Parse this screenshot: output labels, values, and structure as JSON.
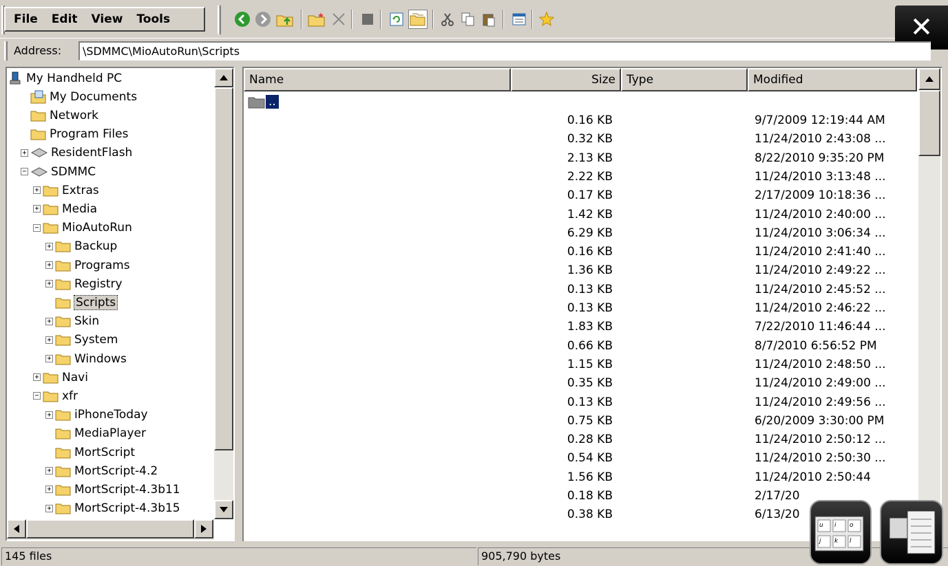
{
  "menu": {
    "file": "File",
    "edit": "Edit",
    "view": "View",
    "tools": "Tools"
  },
  "toolbar_icons": [
    "back-icon",
    "forward-icon",
    "up-folder-icon",
    "new-folder-icon",
    "delete-icon",
    "properties-icon",
    "refresh-icon",
    "folders-icon",
    "cut-icon",
    "copy-icon",
    "paste-icon",
    "view-options-icon",
    "favorites-icon"
  ],
  "close_label": "✕",
  "address": {
    "label": "Address:",
    "value": "\\SDMMC\\MioAutoRun\\Scripts"
  },
  "tree": [
    {
      "label": "My Handheld PC",
      "level": 0,
      "expander": "",
      "icon": "pc"
    },
    {
      "label": "My Documents",
      "level": 1,
      "expander": "",
      "icon": "docs"
    },
    {
      "label": "Network",
      "level": 1,
      "expander": "",
      "icon": "folder"
    },
    {
      "label": "Program Files",
      "level": 1,
      "expander": "",
      "icon": "folder"
    },
    {
      "label": "ResidentFlash",
      "level": 1,
      "expander": "+",
      "icon": "drive"
    },
    {
      "label": "SDMMC",
      "level": 1,
      "expander": "-",
      "icon": "drive"
    },
    {
      "label": "Extras",
      "level": 2,
      "expander": "+",
      "icon": "folder"
    },
    {
      "label": "Media",
      "level": 2,
      "expander": "+",
      "icon": "folder"
    },
    {
      "label": "MioAutoRun",
      "level": 2,
      "expander": "-",
      "icon": "folder"
    },
    {
      "label": "Backup",
      "level": 3,
      "expander": "+",
      "icon": "folder"
    },
    {
      "label": "Programs",
      "level": 3,
      "expander": "+",
      "icon": "folder"
    },
    {
      "label": "Registry",
      "level": 3,
      "expander": "+",
      "icon": "folder"
    },
    {
      "label": "Scripts",
      "level": 3,
      "expander": "",
      "icon": "folder",
      "selected": true
    },
    {
      "label": "Skin",
      "level": 3,
      "expander": "+",
      "icon": "folder"
    },
    {
      "label": "System",
      "level": 3,
      "expander": "+",
      "icon": "folder"
    },
    {
      "label": "Windows",
      "level": 3,
      "expander": "+",
      "icon": "folder"
    },
    {
      "label": "Navi",
      "level": 2,
      "expander": "+",
      "icon": "folder"
    },
    {
      "label": "xfr",
      "level": 2,
      "expander": "-",
      "icon": "folder"
    },
    {
      "label": "iPhoneToday",
      "level": 3,
      "expander": "+",
      "icon": "folder"
    },
    {
      "label": "MediaPlayer",
      "level": 3,
      "expander": "",
      "icon": "folder"
    },
    {
      "label": "MortScript",
      "level": 3,
      "expander": "",
      "icon": "folder"
    },
    {
      "label": "MortScript-4.2",
      "level": 3,
      "expander": "+",
      "icon": "folder"
    },
    {
      "label": "MortScript-4.3b11",
      "level": 3,
      "expander": "+",
      "icon": "folder"
    },
    {
      "label": "MortScript-4.3b15",
      "level": 3,
      "expander": "+",
      "icon": "folder"
    }
  ],
  "columns": {
    "name": "Name",
    "size": "Size",
    "type": "Type",
    "modified": "Modified"
  },
  "parent_entry": "..",
  "files": [
    {
      "size": "0.16 KB",
      "modified": "9/7/2009 12:19:44 AM"
    },
    {
      "size": "0.32 KB",
      "modified": "11/24/2010 2:43:08 ..."
    },
    {
      "size": "2.13 KB",
      "modified": "8/22/2010 9:35:20 PM"
    },
    {
      "size": "2.22 KB",
      "modified": "11/24/2010 3:13:48 ..."
    },
    {
      "size": "0.17 KB",
      "modified": "2/17/2009 10:18:36 ..."
    },
    {
      "size": "1.42 KB",
      "modified": "11/24/2010 2:40:00 ..."
    },
    {
      "size": "6.29 KB",
      "modified": "11/24/2010 3:06:34 ..."
    },
    {
      "size": "0.16 KB",
      "modified": "11/24/2010 2:41:40 ..."
    },
    {
      "size": "1.36 KB",
      "modified": "11/24/2010 2:49:22 ..."
    },
    {
      "size": "0.13 KB",
      "modified": "11/24/2010 2:45:52 ..."
    },
    {
      "size": "0.13 KB",
      "modified": "11/24/2010 2:46:22 ..."
    },
    {
      "size": "1.83 KB",
      "modified": "7/22/2010 11:46:44 ..."
    },
    {
      "size": "0.66 KB",
      "modified": "8/7/2010 6:56:52 PM"
    },
    {
      "size": "1.15 KB",
      "modified": "11/24/2010 2:48:50 ..."
    },
    {
      "size": "0.35 KB",
      "modified": "11/24/2010 2:49:00 ..."
    },
    {
      "size": "0.13 KB",
      "modified": "11/24/2010 2:49:56 ..."
    },
    {
      "size": "0.75 KB",
      "modified": "6/20/2009 3:30:00 PM"
    },
    {
      "size": "0.28 KB",
      "modified": "11/24/2010 2:50:12 ..."
    },
    {
      "size": "0.54 KB",
      "modified": "11/24/2010 2:50:30 ..."
    },
    {
      "size": "1.56 KB",
      "modified": "11/24/2010 2:50:44"
    },
    {
      "size": "0.18 KB",
      "modified": "2/17/20"
    },
    {
      "size": "0.38 KB",
      "modified": "6/13/20"
    }
  ],
  "status": {
    "files": "145 files",
    "bytes": "905,790 bytes"
  },
  "keyboard_keys": [
    "u",
    "i",
    "o",
    "j",
    "k",
    "l"
  ],
  "colors": {
    "chrome": "#d4d0c8",
    "selection": "#0a246a",
    "folder": "#f5d36a"
  }
}
